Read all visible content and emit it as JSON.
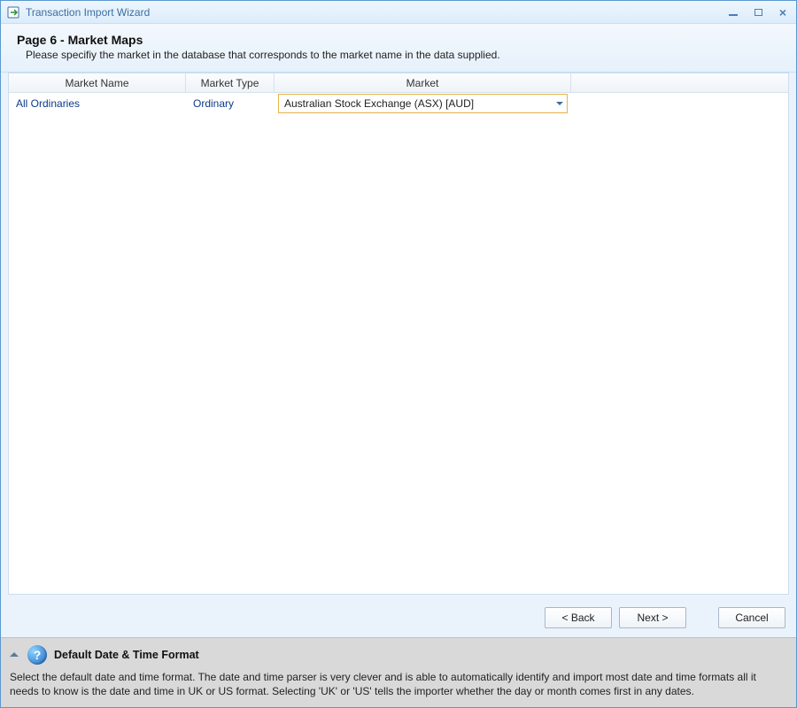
{
  "window": {
    "title": "Transaction Import Wizard"
  },
  "header": {
    "title": "Page 6 - Market Maps",
    "subtitle": "Please specifiy the market in the database that corresponds to the market name in the data supplied."
  },
  "grid": {
    "columns": {
      "market_name": "Market Name",
      "market_type": "Market Type",
      "market": "Market"
    },
    "rows": [
      {
        "market_name": "All Ordinaries",
        "market_type": "Ordinary",
        "market_selected": "Australian Stock Exchange (ASX) [AUD]"
      }
    ]
  },
  "buttons": {
    "back": "< Back",
    "next": "Next >",
    "cancel": "Cancel"
  },
  "info": {
    "title": "Default Date & Time Format",
    "body": "Select the default date and time format. The date and time parser is very clever and is able to automatically identify and import most date and time formats all it needs to know is the date and time in UK or US format. Selecting 'UK' or 'US' tells the importer whether the day or month comes first in any dates."
  }
}
